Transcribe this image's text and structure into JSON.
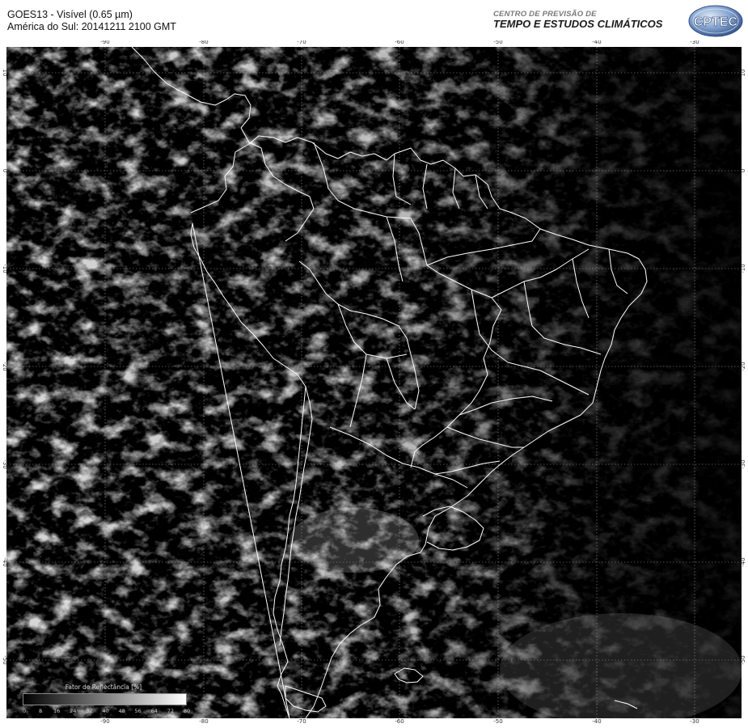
{
  "header": {
    "title_line1": "GOES13 - Visível (0.65 µm)",
    "title_line2": "América do Sul: 20141211 2100 GMT",
    "brand_sub": "CENTRO DE PREVISÃO DE",
    "brand_main": "TEMPO E ESTUDOS CLIMÁTICOS",
    "logo_text": "CPTEC"
  },
  "axes": {
    "longitudes": [
      "-90",
      "-80",
      "-70",
      "-60",
      "-50",
      "-40",
      "-30"
    ],
    "latitudes": [
      "10",
      "0",
      "-10",
      "-20",
      "-30",
      "-40",
      "-50"
    ]
  },
  "legend": {
    "title": "Fator de Reflectância [%]",
    "ticks": [
      "0",
      "8",
      "16",
      "24",
      "32",
      "40",
      "48",
      "56",
      "64",
      "72",
      "80"
    ]
  },
  "colors": {
    "background": "#000000",
    "coastline": "#ffffff",
    "grid": "#9a9a9a",
    "cloud": "#d8d8d8"
  }
}
